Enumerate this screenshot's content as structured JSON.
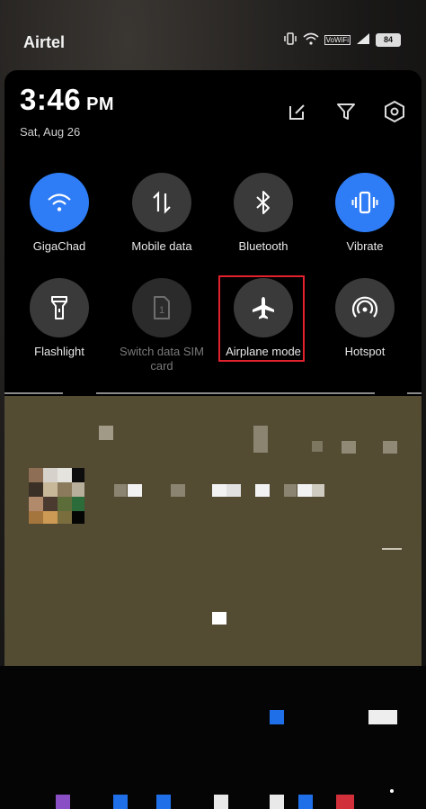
{
  "status_bar": {
    "carrier": "Airtel",
    "icons": [
      "vibrate-icon",
      "wifi-icon",
      "vowifi-icon",
      "signal-icon"
    ],
    "vowifi_text": "VoWiFi",
    "battery_level": "84"
  },
  "header": {
    "time": "3:46",
    "ampm": "PM",
    "date": "Sat, Aug 26",
    "actions": [
      "edit-icon",
      "filter-icon",
      "settings-icon"
    ]
  },
  "tiles": [
    {
      "label": "GigaChad",
      "icon": "wifi-icon",
      "state": "active"
    },
    {
      "label": "Mobile data",
      "icon": "mobile-data-icon",
      "state": "inactive"
    },
    {
      "label": "Bluetooth",
      "icon": "bluetooth-icon",
      "state": "inactive"
    },
    {
      "label": "Vibrate",
      "icon": "vibrate-icon",
      "state": "active"
    },
    {
      "label": "Flashlight",
      "icon": "flashlight-icon",
      "state": "inactive"
    },
    {
      "label": "Switch data SIM card",
      "icon": "sim-icon",
      "state": "disabled"
    },
    {
      "label": "Airplane mode",
      "icon": "airplane-icon",
      "state": "inactive",
      "highlighted": true
    },
    {
      "label": "Hotspot",
      "icon": "hotspot-icon",
      "state": "inactive"
    }
  ],
  "colors": {
    "active_tile": "#2f7df6",
    "inactive_tile": "#3a3a3a",
    "highlight_box": "#e1212e",
    "blurred_notification": "#544b33"
  }
}
